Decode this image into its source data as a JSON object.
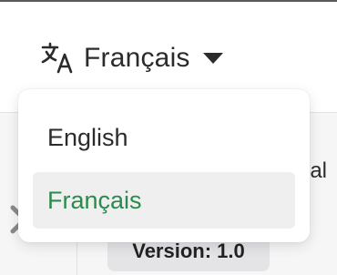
{
  "header": {
    "language_switcher": {
      "current": "Français",
      "icon": "translate-icon",
      "caret_icon": "caret-down-icon"
    }
  },
  "language_menu": {
    "items": [
      {
        "label": "English",
        "selected": false
      },
      {
        "label": "Français",
        "selected": true
      }
    ],
    "selected_color": "#2b8a4e"
  },
  "background": {
    "partial_text": "rial",
    "version_badge": "Version: 1.0",
    "close_icon": "close-icon"
  }
}
